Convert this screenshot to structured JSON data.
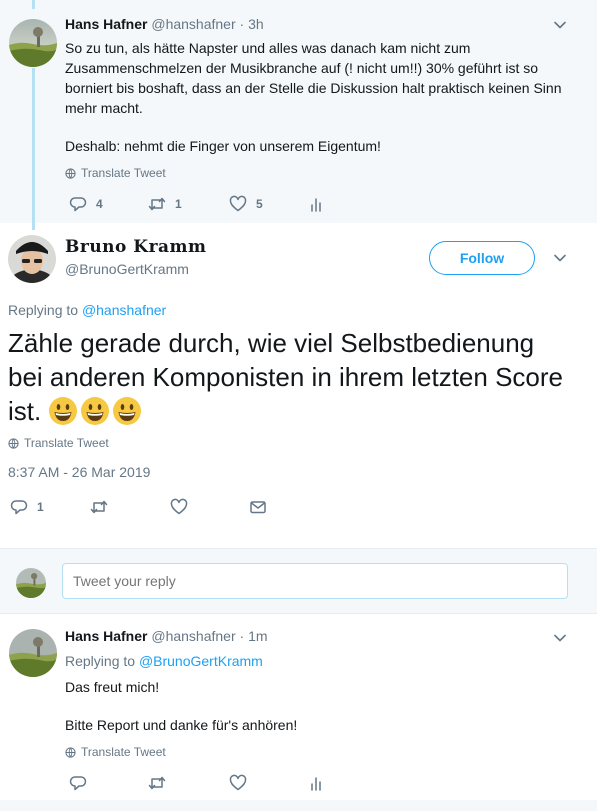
{
  "tweet_parent": {
    "name": "Hans Hafner",
    "handle": "@hanshafner",
    "time": "· 3h",
    "lines": [
      "So zu tun, als hätte Napster und alles was danach kam nicht zum",
      "Zusammenschmelzen der Musikbranche auf (! nicht um!!) 30% geführt ist so",
      "borniert bis boshaft, dass an der Stelle die Diskussion halt praktisch keinen Sinn",
      "mehr macht."
    ],
    "line2": "Deshalb: nehmt die Finger von unserem Eigentum!",
    "translate": "Translate Tweet",
    "replies": "4",
    "retweets": "1",
    "likes": "5"
  },
  "tweet_main": {
    "name": "Bruno Kramm",
    "handle": "@BrunoGertKramm",
    "follow": "Follow",
    "replying_prefix": "Replying to",
    "replying_to": "@hanshafner",
    "text": "Zähle gerade durch, wie viel Selbstbedienung bei anderen Komponisten in ihrem letzten Score ist.",
    "emoji_count": 3,
    "translate": "Translate Tweet",
    "timestamp": "8:37 AM - 26 Mar 2019",
    "replies": "1"
  },
  "reply_box": {
    "placeholder": "Tweet your reply"
  },
  "tweet_reply": {
    "name": "Hans Hafner",
    "handle": "@hanshafner",
    "time": "· 1m",
    "replying_prefix": "Replying to",
    "replying_to": "@BrunoGertKramm",
    "line1": "Das freut mich!",
    "line2": "Bitte Report und danke für's anhören!",
    "translate": "Translate Tweet"
  },
  "colors": {
    "accent": "#1da1f2",
    "muted": "#657786",
    "thread_line": "#b5dff3",
    "background_alt": "#f5f8fa"
  }
}
